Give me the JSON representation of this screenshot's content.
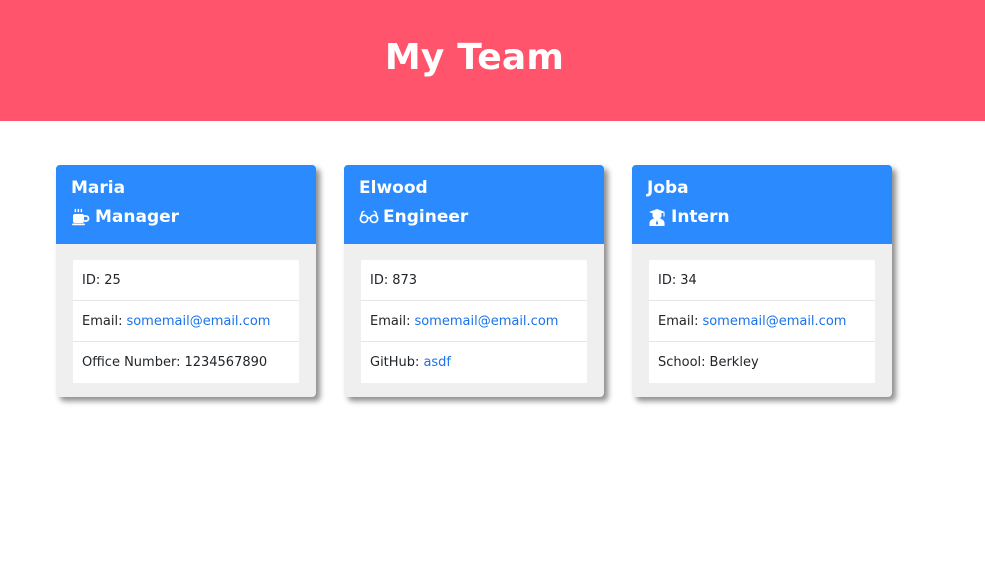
{
  "header": {
    "title": "My Team"
  },
  "cards": [
    {
      "name": "Maria",
      "role": "Manager",
      "role_icon": "coffee-mug-icon",
      "id_label": "ID:",
      "id_value": "25",
      "email_label": "Email:",
      "email_value": "somemail@email.com",
      "extra_label": "Office Number:",
      "extra_value": "1234567890"
    },
    {
      "name": "Elwood",
      "role": "Engineer",
      "role_icon": "glasses-icon",
      "id_label": "ID:",
      "id_value": "873",
      "email_label": "Email:",
      "email_value": "somemail@email.com",
      "extra_label": "GitHub:",
      "extra_value": "asdf"
    },
    {
      "name": "Joba",
      "role": "Intern",
      "role_icon": "graduate-icon",
      "id_label": "ID:",
      "id_value": "34",
      "email_label": "Email:",
      "email_value": "somemail@email.com",
      "extra_label": "School:",
      "extra_value": "Berkley"
    }
  ],
  "colors": {
    "banner": "#ff546c",
    "card_header": "#2b8bfe",
    "link": "#1a73e8"
  }
}
